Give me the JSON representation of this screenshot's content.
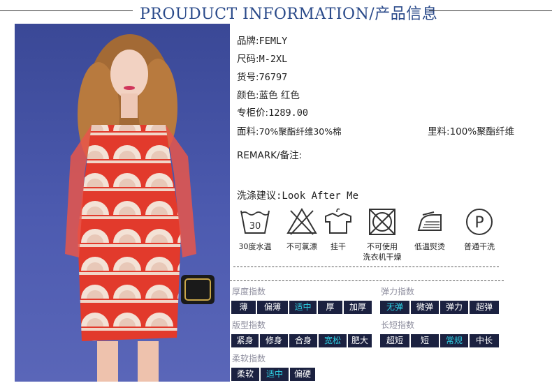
{
  "header": {
    "title": "PROUDUCT INFORMATION/产品信息"
  },
  "info": {
    "brand_label": "品牌:",
    "brand": "FEMLY",
    "size_label": "尺码:",
    "size": "M-2XL",
    "sku_label": "货号:",
    "sku": "76797",
    "color_label": "颜色:",
    "color": "蓝色 红色",
    "price_label": "专柜价:",
    "price": "1289.00",
    "fabric_label": "面料:",
    "fabric": "70%聚酯纤维30%棉",
    "lining_label": "里料:",
    "lining": "100%聚酯纤维",
    "remark_label": "REMARK/备注:"
  },
  "care": {
    "title": "洗涤建议:Look After Me",
    "wash_temp": "30",
    "items": [
      "30度水温",
      "不可氯漂",
      "挂干",
      "不可使用",
      "洗衣机干燥",
      "低温熨烫",
      "普通干洗"
    ],
    "dryclean_letter": "P"
  },
  "indices": {
    "thickness": {
      "title": "厚度指数",
      "options": [
        "薄",
        "偏薄",
        "适中",
        "厚",
        "加厚"
      ],
      "selected": "适中"
    },
    "elasticity": {
      "title": "弹力指数",
      "options": [
        "无弹",
        "微弹",
        "弹力",
        "超弹"
      ],
      "selected": "无弹"
    },
    "fit": {
      "title": "版型指数",
      "options": [
        "紧身",
        "修身",
        "合身",
        "宽松",
        "肥大"
      ],
      "selected": "宽松"
    },
    "length": {
      "title": "长短指数",
      "options": [
        "超短",
        "短",
        "常规",
        "中长"
      ],
      "selected": "常规"
    },
    "softness": {
      "title": "柔软指数",
      "options": [
        "柔软",
        "适中",
        "偏硬"
      ],
      "selected": "适中"
    }
  },
  "colors": {
    "accent": "#2a4a8a",
    "selected_text": "#2ed3e6",
    "option_bg": "#1b2140",
    "dress_red": "#e23a2c",
    "background_blue": "#4350a4"
  }
}
